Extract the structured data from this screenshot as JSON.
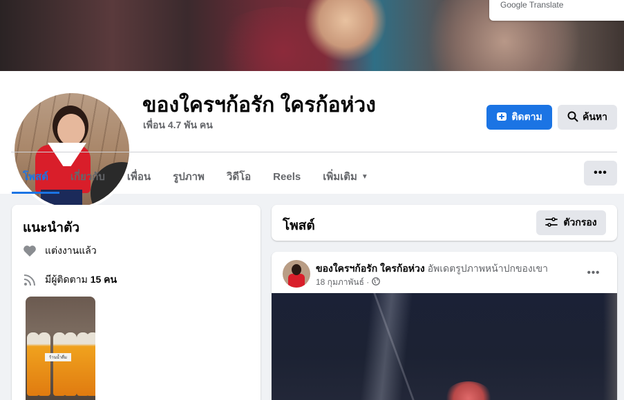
{
  "translate_widget": {
    "brand": "Google",
    "product": "Translate"
  },
  "profile": {
    "name": "ของใครฯก้อรัก ใครก้อห่วง",
    "friends": "เพื่อน 4.7 พัน คน"
  },
  "actions": {
    "follow_label": "ติดตาม",
    "search_label": "ค้นหา",
    "more_label": "•••"
  },
  "tabs": [
    {
      "label": "โพสต์",
      "active": true
    },
    {
      "label": "เกี่ยวกับ",
      "active": false
    },
    {
      "label": "เพื่อน",
      "active": false
    },
    {
      "label": "รูปภาพ",
      "active": false
    },
    {
      "label": "วิดีโอ",
      "active": false
    },
    {
      "label": "Reels",
      "active": false
    },
    {
      "label": "เพิ่มเติม",
      "active": false
    }
  ],
  "intro": {
    "title": "แนะนำตัว",
    "relationship": "แต่งงานแล้ว",
    "followers_prefix": "มีผู้ติดตาม ",
    "followers_count": "15 คน",
    "featured_label": "ร้านน้ำดื่ม"
  },
  "posts_header": {
    "title": "โพสต์",
    "filter_label": "ตัวกรอง"
  },
  "post": {
    "author": "ของใครฯก้อรัก ใครก้อห่วง",
    "action": " อัพเดตรูปภาพหน้าปกของเขา",
    "date": "18 กุมภาพันธ์ ·",
    "more_label": "•••"
  },
  "colors": {
    "accent": "#1b74e4",
    "secondary_btn": "#e4e6eb",
    "muted_text": "#65676b",
    "background": "#f0f2f5"
  }
}
